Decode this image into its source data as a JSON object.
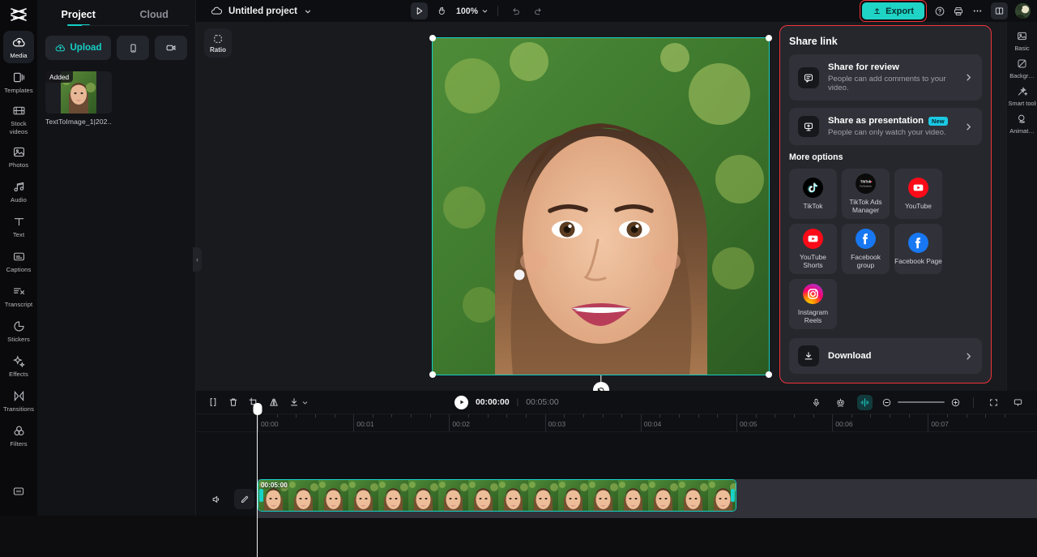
{
  "app": {
    "name": "CapCut",
    "logo_icon": "capcut-logo-icon"
  },
  "left_rail": {
    "items": [
      {
        "label": "Media",
        "icon": "media-cloud-icon",
        "active": true
      },
      {
        "label": "Templates",
        "icon": "templates-icon",
        "active": false
      },
      {
        "label": "Stock videos",
        "icon": "stock-videos-icon",
        "active": false
      },
      {
        "label": "Photos",
        "icon": "photos-icon",
        "active": false
      },
      {
        "label": "Audio",
        "icon": "audio-note-icon",
        "active": false
      },
      {
        "label": "Text",
        "icon": "text-icon",
        "active": false
      },
      {
        "label": "Captions",
        "icon": "captions-icon",
        "active": false
      },
      {
        "label": "Transcript",
        "icon": "transcript-icon",
        "active": false
      },
      {
        "label": "Stickers",
        "icon": "stickers-icon",
        "active": false
      },
      {
        "label": "Effects",
        "icon": "effects-sparkle-icon",
        "active": false
      },
      {
        "label": "Transitions",
        "icon": "transitions-icon",
        "active": false
      },
      {
        "label": "Filters",
        "icon": "filters-icon",
        "active": false
      }
    ],
    "bottom_icon": "more-panel-icon"
  },
  "media_panel": {
    "tabs": [
      {
        "label": "Project",
        "active": true
      },
      {
        "label": "Cloud",
        "active": false
      }
    ],
    "upload_label": "Upload",
    "upload_icon": "upload-cloud-icon",
    "device_icon": "phone-icon",
    "record_icon": "camera-record-icon",
    "items": [
      {
        "name": "TextToImage_1|202…",
        "badge": "Added"
      }
    ]
  },
  "topbar": {
    "cloud_icon": "cloud-icon",
    "project_name": "Untitled project",
    "dropdown_icon": "chevron-down-icon",
    "select_tool_icon": "cursor-play-icon",
    "hand_tool_icon": "hand-icon",
    "zoom_level": "100%",
    "undo_icon": "undo-icon",
    "redo_icon": "redo-icon",
    "export_label": "Export",
    "export_icon": "export-upload-icon",
    "help_icon": "help-circle-icon",
    "print_icon": "printer-icon",
    "more_icon": "more-horizontal-icon",
    "layout_icon": "split-layout-icon",
    "avatar_icon": "avatar"
  },
  "stage": {
    "ratio_label": "Ratio",
    "ratio_icon": "ratio-crop-icon",
    "collapse_icon": "chevron-left-icon"
  },
  "share_panel": {
    "title": "Share link",
    "rows": [
      {
        "title": "Share for review",
        "subtitle": "People can add comments to your video.",
        "icon": "comment-bubble-icon",
        "badge": ""
      },
      {
        "title": "Share as presentation",
        "subtitle": "People can only watch your video.",
        "icon": "presentation-icon",
        "badge": "New"
      }
    ],
    "more_options_title": "More options",
    "tiles": [
      {
        "label": "TikTok",
        "icon": "tiktok-icon"
      },
      {
        "label": "TikTok Ads Manager",
        "icon": "tiktok-ads-manager-icon"
      },
      {
        "label": "YouTube",
        "icon": "youtube-icon"
      },
      {
        "label": "YouTube Shorts",
        "icon": "youtube-shorts-icon"
      },
      {
        "label": "Facebook group",
        "icon": "facebook-icon"
      },
      {
        "label": "Facebook Page",
        "icon": "facebook-icon"
      },
      {
        "label": "Instagram Reels",
        "icon": "instagram-icon"
      }
    ],
    "download_label": "Download",
    "download_icon": "download-icon",
    "chevron_icon": "chevron-right-icon",
    "highlight_color": "#f0333a"
  },
  "right_rail": {
    "items": [
      {
        "label": "Basic",
        "icon": "basic-image-icon"
      },
      {
        "label": "Backgr…",
        "icon": "background-icon"
      },
      {
        "label": "Smart tools",
        "icon": "smart-tools-wand-icon"
      },
      {
        "label": "Animat…",
        "icon": "animation-icon"
      }
    ]
  },
  "timeline": {
    "tools": [
      {
        "icon": "split-icon",
        "label": ""
      },
      {
        "icon": "delete-trash-icon",
        "label": ""
      },
      {
        "icon": "crop-icon",
        "label": ""
      },
      {
        "icon": "mirror-flip-icon",
        "label": ""
      },
      {
        "icon": "download-arrow-icon",
        "label": ""
      }
    ],
    "play_icon": "play-icon",
    "current_time": "00:00:00",
    "separator": "|",
    "total_time": "00:05:00",
    "right_tools": [
      {
        "icon": "microphone-icon",
        "active": false
      },
      {
        "icon": "auto-captions-icon",
        "active": false
      },
      {
        "icon": "audio-waveform-icon",
        "active": true
      }
    ],
    "zoom_out_icon": "zoom-out-icon",
    "zoom_in_icon": "zoom-in-icon",
    "fit-screen_icon": "fit-screen-icon",
    "preview-mode_icon": "preview-monitor-icon",
    "ruler_labels": [
      "00:00",
      "00:01",
      "00:02",
      "00:03",
      "00:04",
      "00:05",
      "00:06",
      "00:07"
    ],
    "track": {
      "mute_icon": "speaker-icon",
      "edit_icon": "pencil-edit-icon",
      "clip_duration": "00:05:00"
    }
  },
  "colors": {
    "accent_teal": "#1fd3c5",
    "selection_cyan": "#14cfc6",
    "highlight_red": "#f0333a",
    "panel_bg": "#26272d",
    "app_bg": "#0d0e11"
  }
}
